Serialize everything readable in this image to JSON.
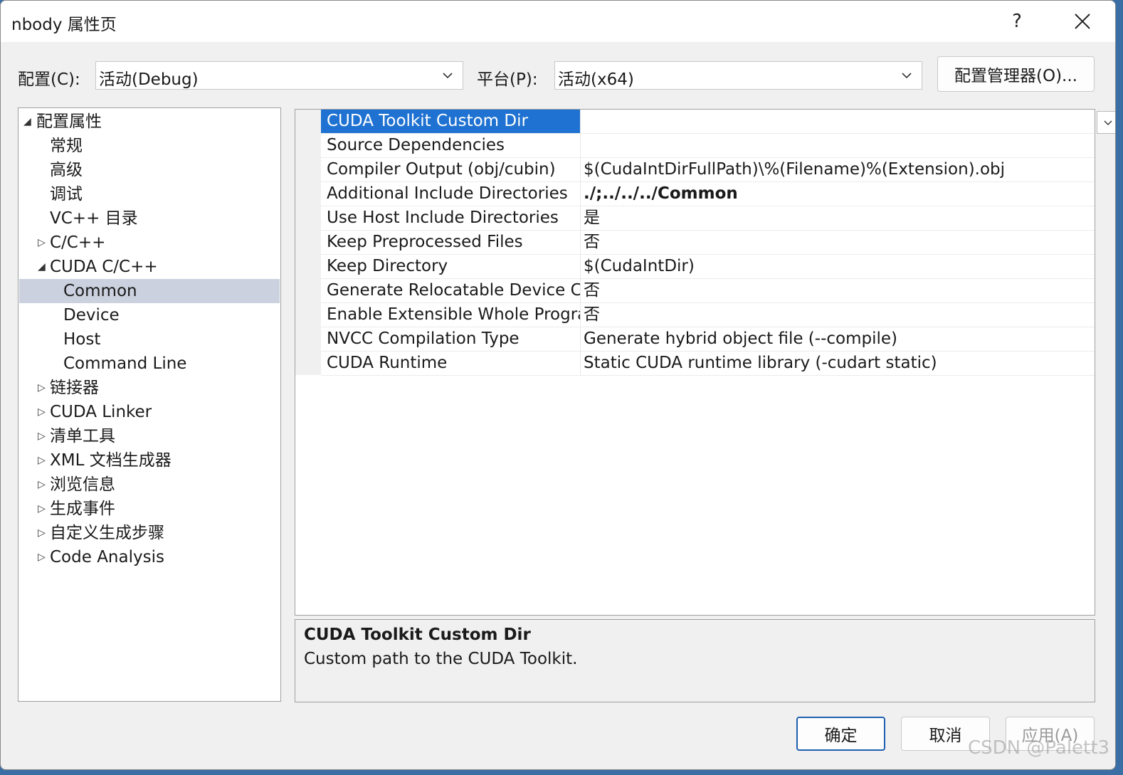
{
  "window": {
    "title": "nbody 属性页",
    "help_label": "?",
    "close_label": "✕"
  },
  "toolbar": {
    "config_label": "配置(C):",
    "config_value": "活动(Debug)",
    "platform_label": "平台(P):",
    "platform_value": "活动(x64)",
    "config_manager_label": "配置管理器(O)..."
  },
  "tree": {
    "items": [
      {
        "label": "配置属性",
        "arrow": "◢"
      },
      {
        "label": "常规",
        "arrow": ""
      },
      {
        "label": "高级",
        "arrow": ""
      },
      {
        "label": "调试",
        "arrow": ""
      },
      {
        "label": "VC++ 目录",
        "arrow": ""
      },
      {
        "label": "C/C++",
        "arrow": "▷"
      },
      {
        "label": "CUDA C/C++",
        "arrow": "◢"
      },
      {
        "label": "Common",
        "arrow": ""
      },
      {
        "label": "Device",
        "arrow": ""
      },
      {
        "label": "Host",
        "arrow": ""
      },
      {
        "label": "Command Line",
        "arrow": ""
      },
      {
        "label": "链接器",
        "arrow": "▷"
      },
      {
        "label": "CUDA Linker",
        "arrow": "▷"
      },
      {
        "label": "清单工具",
        "arrow": "▷"
      },
      {
        "label": "XML 文档生成器",
        "arrow": "▷"
      },
      {
        "label": "浏览信息",
        "arrow": "▷"
      },
      {
        "label": "生成事件",
        "arrow": "▷"
      },
      {
        "label": "自定义生成步骤",
        "arrow": "▷"
      },
      {
        "label": "Code Analysis",
        "arrow": "▷"
      }
    ]
  },
  "properties": {
    "rows": [
      {
        "name": "CUDA Toolkit Custom Dir",
        "value": ""
      },
      {
        "name": "Source Dependencies",
        "value": ""
      },
      {
        "name": "Compiler Output (obj/cubin)",
        "value": "$(CudaIntDirFullPath)\\%(Filename)%(Extension).obj"
      },
      {
        "name": "Additional Include Directories",
        "value": "./;../../../Common"
      },
      {
        "name": "Use Host Include Directories",
        "value": "是"
      },
      {
        "name": "Keep Preprocessed Files",
        "value": "否"
      },
      {
        "name": "Keep Directory",
        "value": "$(CudaIntDir)"
      },
      {
        "name": "Generate Relocatable Device Code",
        "value": "否"
      },
      {
        "name": "Enable Extensible Whole Program Compilation",
        "value": "否"
      },
      {
        "name": "NVCC Compilation Type",
        "value": "Generate hybrid object file (--compile)"
      },
      {
        "name": "CUDA Runtime",
        "value": "Static CUDA runtime library (-cudart static)"
      }
    ]
  },
  "description": {
    "title": "CUDA Toolkit Custom Dir",
    "body": "Custom path to the CUDA Toolkit."
  },
  "footer": {
    "ok_label": "确定",
    "cancel_label": "取消",
    "apply_label": "应用(A)"
  },
  "watermark": "CSDN @Palett3"
}
